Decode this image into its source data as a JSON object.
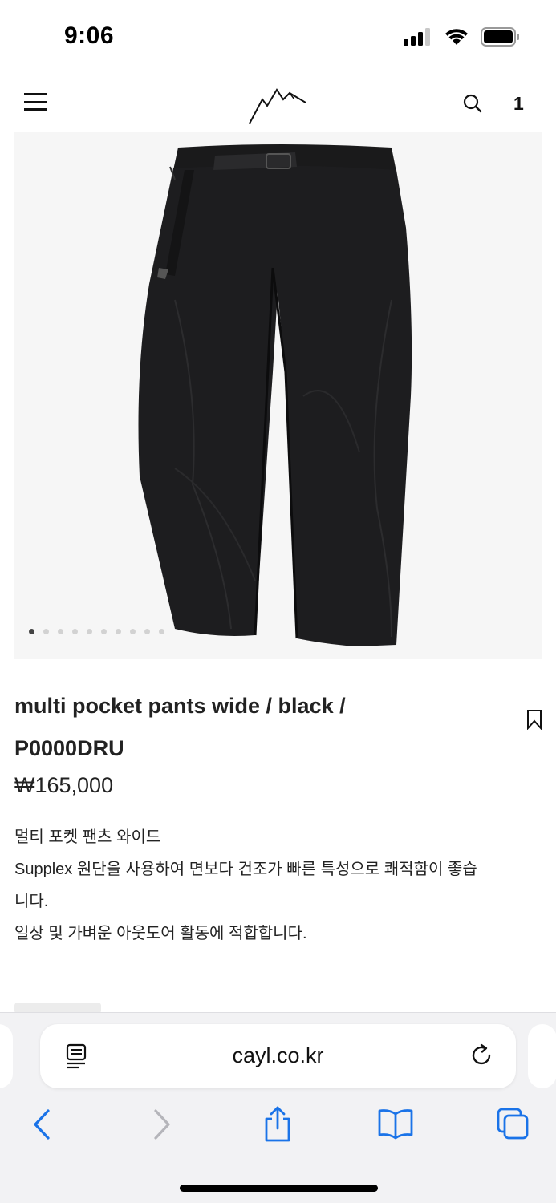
{
  "status_bar": {
    "time": "9:06",
    "icons": [
      "cellular-signal-icon",
      "wifi-icon",
      "battery-icon"
    ]
  },
  "header": {
    "logo": "mountain-logo",
    "cart_count": "1",
    "icons": [
      "menu-icon",
      "search-icon"
    ]
  },
  "gallery": {
    "image": "black-pants-photo",
    "slide_count": 10,
    "active_slide": 1
  },
  "product": {
    "title_line1": "multi pocket pants wide / black /",
    "title_line2": "P0000DRU",
    "price": "₩165,000",
    "description": [
      "멀티 포켓 팬츠 와이드",
      "Supplex 원단을 사용하여 면보다 건조가 빠른 특성으로 쾌적함이 좋습",
      "니다.",
      "일상 및 가벼운 아웃도어 활동에 적합합니다."
    ],
    "bookmark_icon": "bookmark-icon"
  },
  "browser": {
    "url": "cayl.co.kr",
    "icons": [
      "reader-mode-icon",
      "reload-icon",
      "back-icon",
      "forward-icon",
      "share-icon",
      "bookmarks-icon",
      "tabs-icon"
    ],
    "accent_color": "#1a73e8",
    "disabled_color": "#b5b5ba"
  }
}
